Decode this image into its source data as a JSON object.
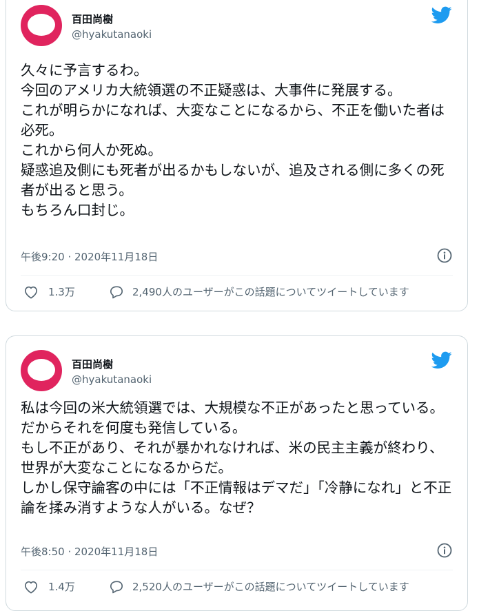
{
  "tweets": [
    {
      "author_name": "百田尚樹",
      "author_handle": "@hyakutanaoki",
      "text": "久々に予言するわ。\n今回のアメリカ大統領選の不正疑惑は、大事件に発展する。\nこれが明らかになれば、大変なことになるから、不正を働いた者は必死。\nこれから何人か死ぬ。\n疑惑追及側にも死者が出るかもしないが、追及される側に多くの死者が出ると思う。\nもちろん口封じ。",
      "timestamp": "午後9:20 · 2020年11月18日",
      "likes": "1.3万",
      "discussion": "2,490人のユーザーがこの話題についてツイートしています"
    },
    {
      "author_name": "百田尚樹",
      "author_handle": "@hyakutanaoki",
      "text": "私は今回の米大統領選では、大規模な不正があったと思っている。だからそれを何度も発信している。\nもし不正があり、それが暴かれなければ、米の民主主義が終わり、世界が大変なことになるからだ。\nしかし保守論客の中には「不正情報はデマだ」「冷静になれ」と不正論を揉み消すような人がいる。なぜ？",
      "timestamp": "午後8:50 · 2020年11月18日",
      "likes": "1.4万",
      "discussion": "2,520人のユーザーがこの話題についてツイートしています"
    }
  ],
  "icons": {
    "brand": "twitter-bird-icon",
    "info": "info-icon",
    "like": "heart-icon",
    "reply": "speech-bubble-icon"
  },
  "colors": {
    "twitter_blue": "#1d9bf0",
    "avatar_red": "#e0245e",
    "secondary_text": "#536471",
    "border": "#cfd9de"
  }
}
